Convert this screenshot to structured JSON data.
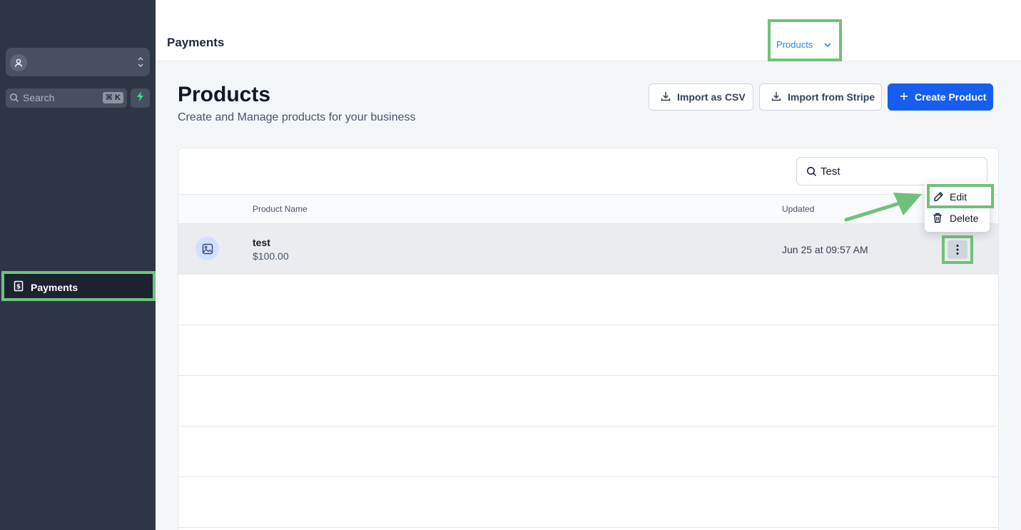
{
  "sidebar": {
    "search_placeholder": "Search",
    "search_shortcut": "⌘ K",
    "nav_item": "Payments"
  },
  "topbar": {
    "title": "Payments",
    "dropdown_label": "Products"
  },
  "page": {
    "title": "Products",
    "subtitle": "Create and Manage products for your business",
    "import_csv": "Import as CSV",
    "import_stripe": "Import from Stripe",
    "create_product": "Create Product"
  },
  "table": {
    "search_value": "Test",
    "columns": [
      "Product Name",
      "Updated"
    ],
    "rows": [
      {
        "name": "test",
        "price": "$100.00",
        "updated": "Jun 25 at 09:57 AM"
      }
    ]
  },
  "menu": {
    "items": [
      "Edit",
      "Delete"
    ]
  },
  "colors": {
    "sidebar_bg": "#2e3646",
    "primary": "#155eef",
    "highlight": "#6fc17a",
    "link": "#1e8ad6"
  }
}
